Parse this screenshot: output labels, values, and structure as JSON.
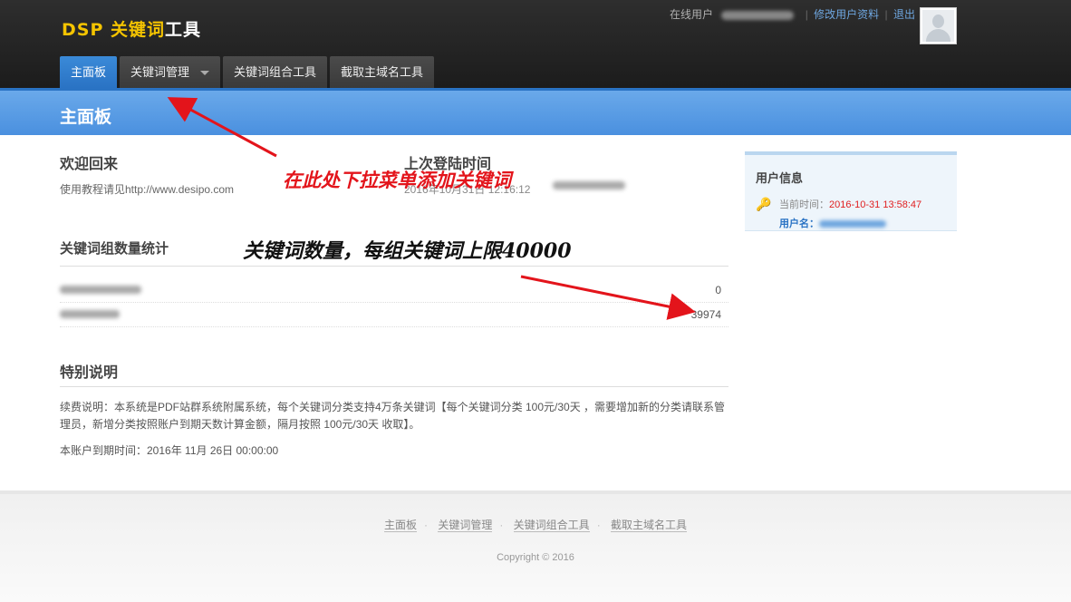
{
  "header": {
    "logo_dsp": "DSP",
    "logo_kw": "关键词",
    "logo_tool": "工具",
    "online_user_label": "在线用户",
    "edit_profile_link": "修改用户资料",
    "logout_link": "退出"
  },
  "nav": {
    "tabs": [
      {
        "label": "主面板"
      },
      {
        "label": "关键词管理"
      },
      {
        "label": "关键词组合工具"
      },
      {
        "label": "截取主域名工具"
      }
    ]
  },
  "page_title": "主面板",
  "welcome": {
    "title": "欢迎回来",
    "tutorial_text": "使用教程请见http://www.desipo.com"
  },
  "last_login": {
    "title": "上次登陆时间",
    "value": "2016年10月31日 12:16:12"
  },
  "stats": {
    "title": "关键词组数量统计",
    "rows": [
      {
        "count": "0"
      },
      {
        "count": "39974"
      }
    ]
  },
  "notes": {
    "title": "特别说明",
    "renewal": "续费说明：本系统是PDF站群系统附属系统，每个关键词分类支持4万条关键词【每个关键词分类 100元/30天 ，需要增加新的分类请联系管理员，新增分类按照账户到期天数计算金额，隔月按照 100元/30天 收取】。",
    "expiry": "本账户到期时间：2016年 11月 26日 00:00:00"
  },
  "user_panel": {
    "title": "用户信息",
    "current_time_label": "当前时间：",
    "current_time_value": "2016-10-31 13:58:47",
    "username_label": "用户名："
  },
  "annotations": {
    "dropdown_hint": "在此处下拉菜单添加关键词",
    "count_hint": "关键词数量，每组关键词上限40000"
  },
  "footer": {
    "links": [
      {
        "label": "主面板"
      },
      {
        "label": "关键词管理"
      },
      {
        "label": "关键词组合工具"
      },
      {
        "label": "截取主域名工具"
      }
    ],
    "copyright": "Copyright © 2016"
  },
  "colors": {
    "header_bg": "#222222",
    "accent_blue": "#3a8ad8",
    "logo_yellow": "#f5c400",
    "annotation_red": "#e3141b",
    "time_red": "#e02020"
  }
}
